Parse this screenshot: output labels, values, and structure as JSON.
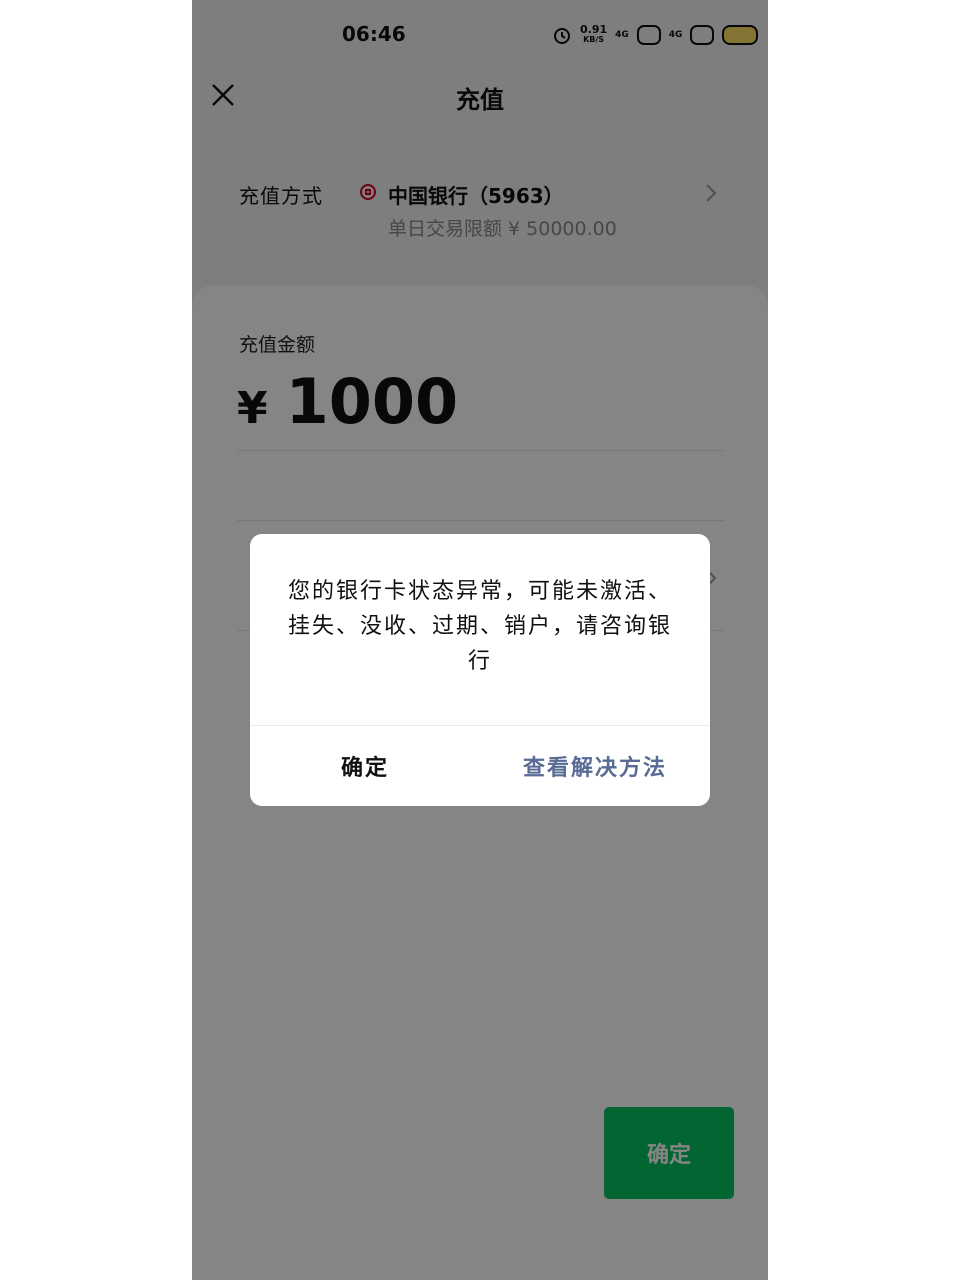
{
  "status_bar": {
    "time": "06:46",
    "net_speed": "0.91",
    "net_unit": "KB/S",
    "signal1": "4G",
    "signal2": "4G"
  },
  "header": {
    "title": "充值"
  },
  "recharge_method": {
    "label": "充值方式",
    "bank_name": "中国银行（5963）",
    "daily_limit": "单日交易限额 ¥ 50000.00"
  },
  "amount": {
    "label": "充值金额",
    "currency": "¥",
    "value": "1000"
  },
  "dialog": {
    "message": "您的银行卡状态异常，可能未激活、挂失、没收、过期、销户，请咨询银行",
    "confirm_label": "确定",
    "solution_label": "查看解决方法"
  },
  "confirm_button": {
    "label": "确定"
  },
  "colors": {
    "primary_green": "#07c160",
    "link_blue": "#576b95",
    "bank_red": "#d6002b"
  }
}
